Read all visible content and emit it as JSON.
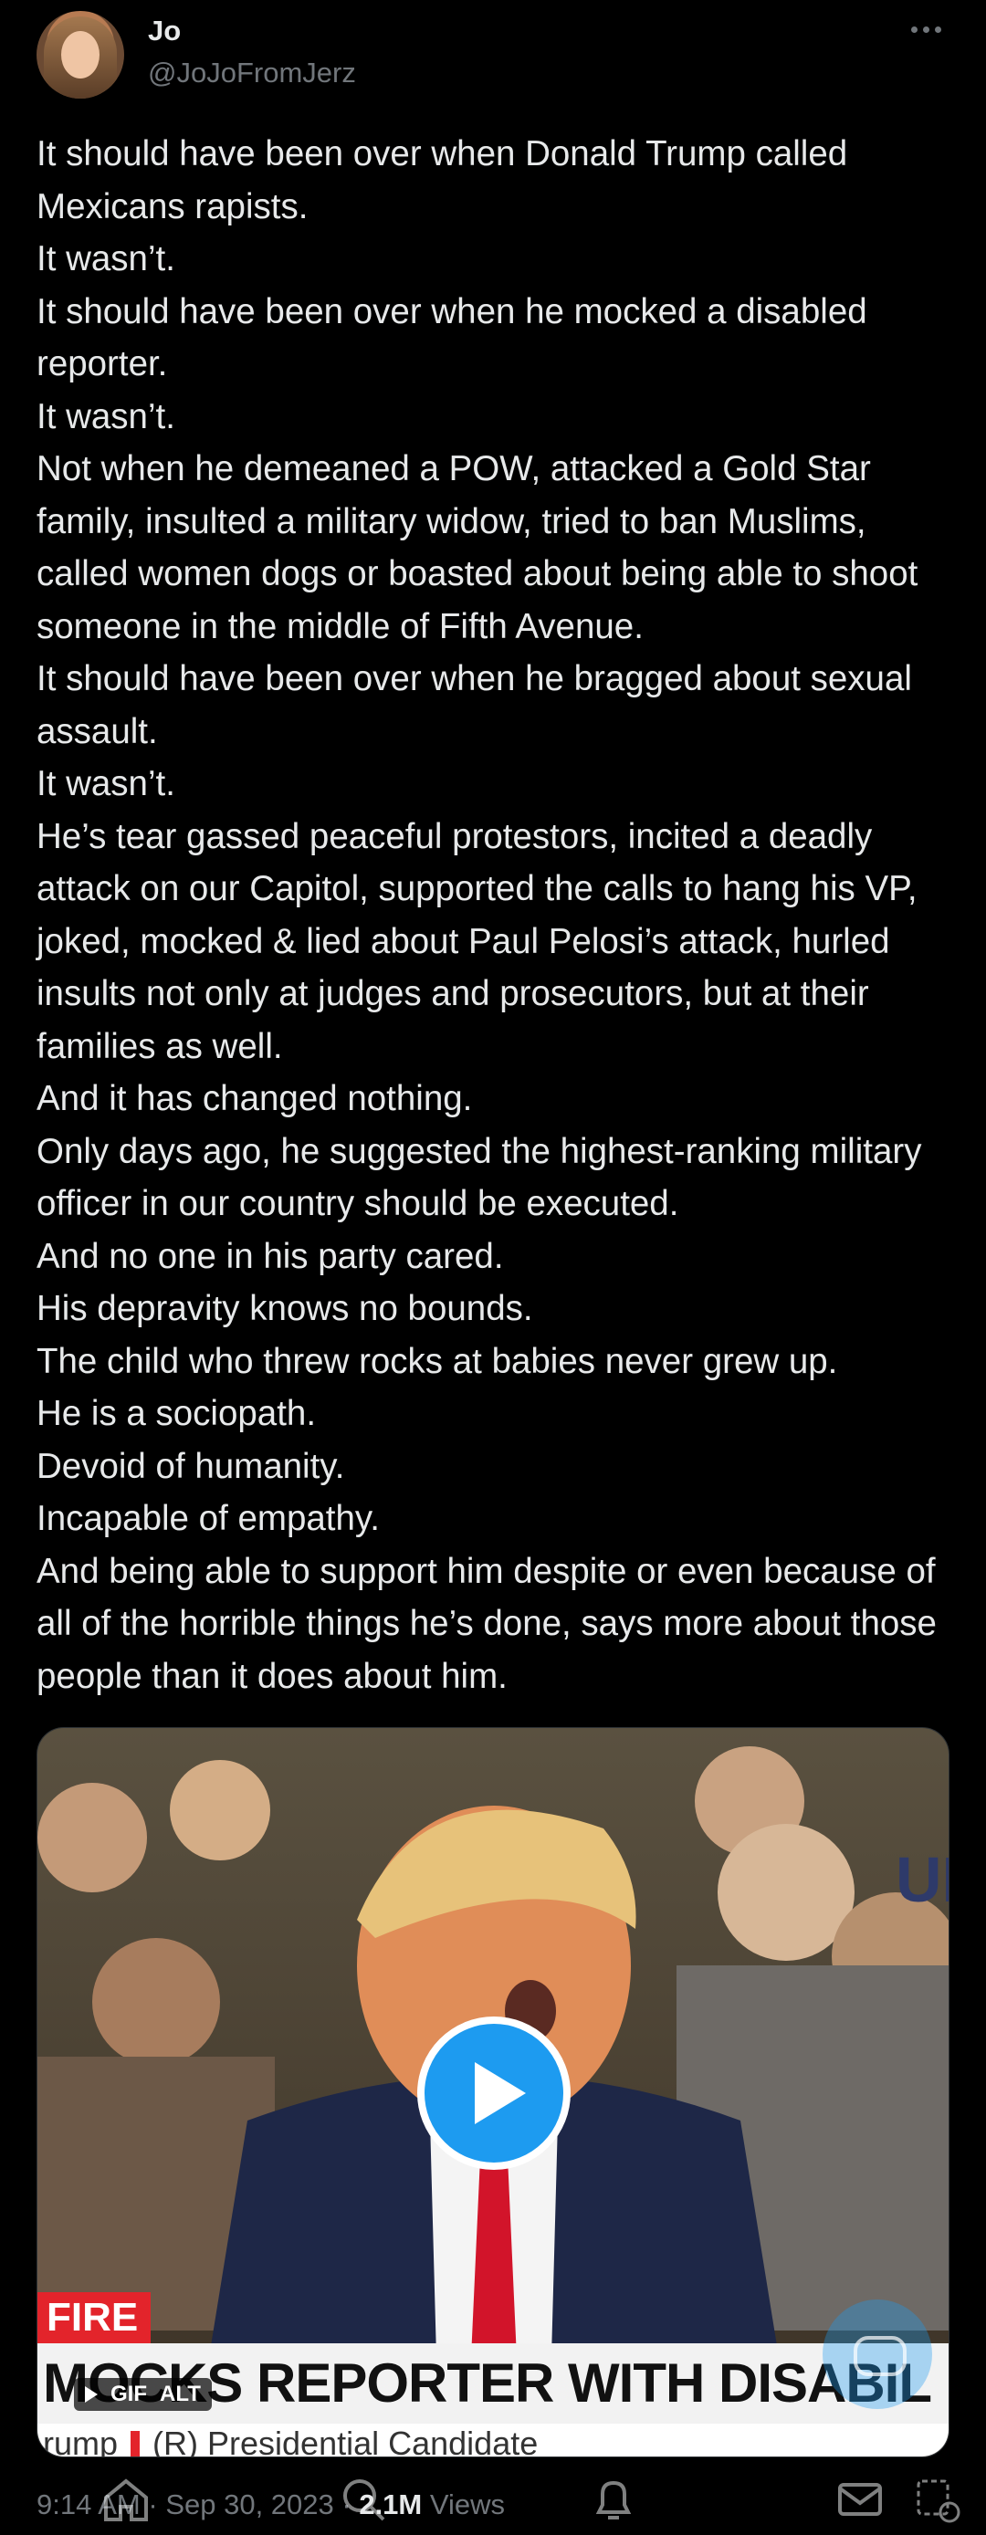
{
  "author": {
    "name": "Jo",
    "handle": "@JoJoFromJerz"
  },
  "tweet": {
    "lines": [
      "It should have been over when Donald Trump called Mexicans rapists.",
      "It wasn’t.",
      "It should have been over when he mocked a disabled reporter.",
      "It wasn’t.",
      "Not when he demeaned a POW, attacked a Gold Star family, insulted a military widow, tried to ban Muslims, called women dogs or boasted about being able to shoot someone in the middle of Fifth Avenue.",
      "It should have been over when he bragged about sexual assault.",
      "It wasn’t.",
      "He’s tear gassed peaceful protestors, incited a deadly attack on our Capitol, supported the calls to hang his VP, joked, mocked & lied about Paul Pelosi’s attack, hurled insults not only at judges and prosecutors, but at their families as well.",
      "And it has changed nothing.",
      "Only days ago, he suggested the highest-ranking military officer in our country should be executed.",
      "And no one in his party cared.",
      "His depravity knows no bounds.",
      "The child who threw rocks at babies never grew up.",
      "He is a sociopath.",
      "Devoid of humanity.",
      "Incapable of empathy.",
      "And being able to support him despite or even because of all of the horrible things he’s done, says more about those people than it does about him."
    ]
  },
  "media": {
    "fire_tag": "FIRE",
    "banner": "MOCKS REPORTER WITH DISABIL",
    "subbanner_left": "rump",
    "subbanner_right": "(R) Presidential Candidate",
    "badge_gif": "GIF",
    "badge_alt": "ALT",
    "backdrop_letters": "UM"
  },
  "meta": {
    "time": "9:14 AM",
    "date": "Sep 30, 2023",
    "views_count": "2.1M",
    "views_label": "Views"
  },
  "icons": [
    "more-icon",
    "play-icon",
    "home-icon",
    "search-icon",
    "bell-icon",
    "mail-icon",
    "grok-icon"
  ],
  "colors": {
    "background": "#000000",
    "text": "#e7e9ea",
    "secondary": "#71767b",
    "accent": "#1d9bf0",
    "news_red": "#e3242b"
  }
}
